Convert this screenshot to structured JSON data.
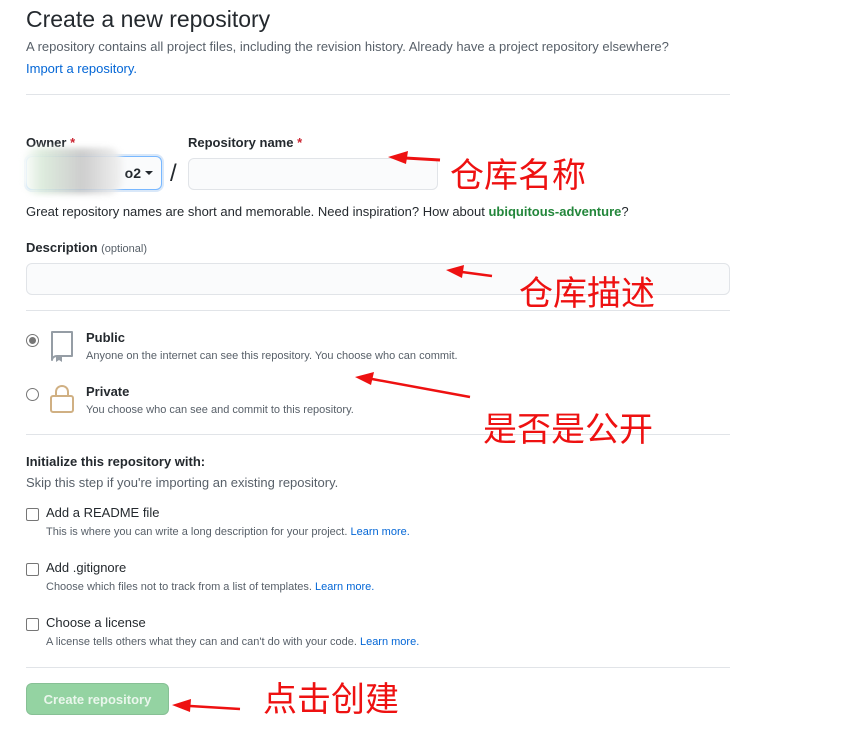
{
  "header": {
    "title": "Create a new repository",
    "subtitle": "A repository contains all project files, including the revision history. Already have a project repository elsewhere?",
    "import_link": "Import a repository."
  },
  "owner": {
    "label": "Owner",
    "required_mark": "*",
    "value_suffix": "o2"
  },
  "separator": "/",
  "repo_name": {
    "label": "Repository name",
    "required_mark": "*",
    "value": ""
  },
  "name_hint": {
    "text": "Great repository names are short and memorable. Need inspiration? How about ",
    "suggestion": "ubiquitous-adventure",
    "end": "?"
  },
  "description": {
    "label": "Description",
    "optional": "(optional)",
    "value": ""
  },
  "visibility": {
    "public": {
      "title": "Public",
      "desc": "Anyone on the internet can see this repository. You choose who can commit.",
      "checked": true
    },
    "private": {
      "title": "Private",
      "desc": "You choose who can see and commit to this repository.",
      "checked": false
    }
  },
  "init": {
    "heading": "Initialize this repository with:",
    "sub": "Skip this step if you're importing an existing repository.",
    "readme": {
      "title": "Add a README file",
      "desc": "This is where you can write a long description for your project.",
      "link": "Learn more."
    },
    "gitignore": {
      "title": "Add .gitignore",
      "desc": "Choose which files not to track from a list of templates.",
      "link": "Learn more."
    },
    "license": {
      "title": "Choose a license",
      "desc": "A license tells others what they can and can't do with your code.",
      "link": "Learn more."
    }
  },
  "submit": {
    "label": "Create repository"
  },
  "annotations": {
    "repo_name": "仓库名称",
    "description": "仓库描述",
    "visibility": "是否是公开",
    "create": "点击创建"
  },
  "colors": {
    "annotation_red": "#ee1111",
    "link_blue": "#0366d6",
    "suggest_green": "#22863a",
    "button_green_disabled": "#94d3a2"
  }
}
